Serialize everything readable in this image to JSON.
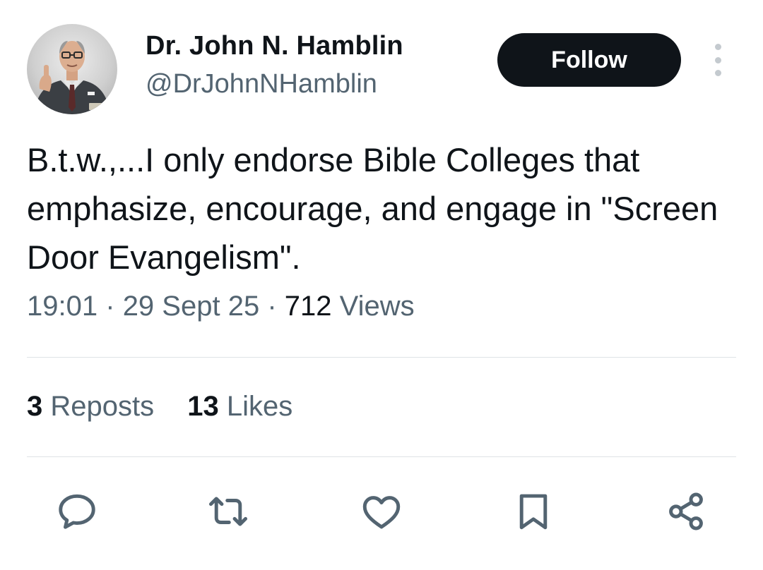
{
  "author": {
    "display_name": "Dr. John N. Hamblin",
    "handle": "@DrJohnNHamblin"
  },
  "follow_label": "Follow",
  "tweet": {
    "text": "B.t.w.,...I only endorse Bible Colleges that emphasize, encourage, and engage in \"Screen Door Evangelism\".",
    "time": "19:01",
    "separator": "·",
    "date": "29 Sept 25",
    "views_count": "712",
    "views_label": "Views"
  },
  "stats": {
    "reposts_count": "3",
    "reposts_label": "Reposts",
    "likes_count": "13",
    "likes_label": "Likes"
  },
  "icons": [
    "reply-icon",
    "repost-icon",
    "like-icon",
    "bookmark-icon",
    "share-icon",
    "more-options-icon"
  ],
  "colors": {
    "primary_text": "#0f1419",
    "secondary_text": "#536471",
    "follow_bg": "#0f1419",
    "divider": "#dfe3e6"
  }
}
